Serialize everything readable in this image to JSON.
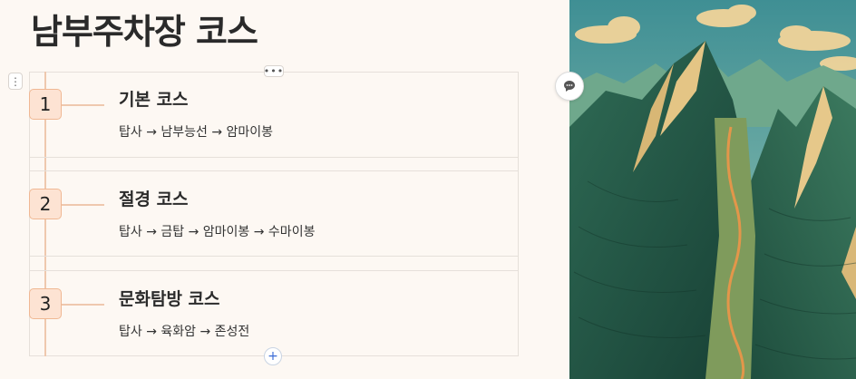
{
  "page": {
    "title": "남부주차장 코스"
  },
  "handles": {
    "block_handle_glyph": "⋮",
    "more_glyph": "•••",
    "add_glyph": "+"
  },
  "steps": [
    {
      "number": "1",
      "title": "기본 코스",
      "route": "탑사 → 남부능선 → 암마이봉"
    },
    {
      "number": "2",
      "title": "절경 코스",
      "route": "탑사 → 금탑 → 암마이봉 → 수마이봉"
    },
    {
      "number": "3",
      "title": "문화탐방 코스",
      "route": "탑사 → 육화암 → 존성전"
    }
  ],
  "colors": {
    "background": "#fdf8f3",
    "badge_fill": "#fde3d3",
    "badge_border": "#f0b893",
    "timeline": "#efc8ae",
    "accent_blue": "#3b6bd6"
  },
  "icons": {
    "block_handle": "vertical-dots-icon",
    "more": "horizontal-dots-icon",
    "add": "plus-icon",
    "comment": "comment-icon"
  }
}
